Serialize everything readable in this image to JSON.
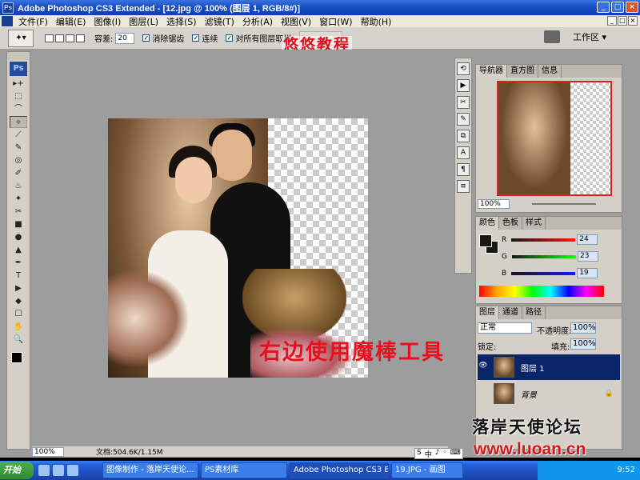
{
  "window": {
    "title": "Adobe Photoshop CS3 Extended - [12.jpg @ 100% (图层 1, RGB/8#)]",
    "minimize": "_",
    "maximize": "□",
    "close": "×"
  },
  "menu": [
    "文件(F)",
    "编辑(E)",
    "图像(I)",
    "图层(L)",
    "选择(S)",
    "滤镜(T)",
    "分析(A)",
    "视图(V)",
    "窗口(W)",
    "帮助(H)"
  ],
  "options": {
    "tolerance_label": "容差:",
    "tolerance_value": "20",
    "antialias_label": "消除锯齿",
    "contiguous_label": "连续",
    "sample_all_label": "对所有图层取样",
    "workspace_label": "工作区 ▾"
  },
  "overlay": {
    "brand": "悠悠教程",
    "caption": "右边使用魔棒工具"
  },
  "toolbox": {
    "ps_badge": "Ps",
    "tools": [
      "▸+",
      "⬚",
      "⌒",
      "✧",
      "⟋",
      "✎",
      "◎",
      "✐",
      "♨",
      "✦",
      "✂",
      "■",
      "●",
      "▲",
      "✒",
      "T",
      "▶",
      "◆",
      "☐",
      "✋",
      "🔍"
    ]
  },
  "navigator": {
    "tabs": [
      "导航器",
      "直方图",
      "信息"
    ],
    "zoom": "100%"
  },
  "color": {
    "tabs": [
      "颜色",
      "色板",
      "样式"
    ],
    "r": "24",
    "g": "23",
    "b": "19",
    "r_label": "R",
    "g_label": "G",
    "b_label": "B",
    "fg_color": "#181713"
  },
  "layers": {
    "tabs": [
      "图层",
      "通道",
      "路径"
    ],
    "blend_mode": "正常",
    "opacity_label": "不透明度:",
    "opacity_value": "100%",
    "lock_label": "锁定:",
    "fill_label": "填充:",
    "fill_value": "100%",
    "items": [
      {
        "name": "图层 1",
        "selected": true
      },
      {
        "name": "背景",
        "selected": false,
        "locked": true
      }
    ]
  },
  "status": {
    "zoom": "100%",
    "doc": "文档:504.6K/1.15M"
  },
  "watermark": {
    "forum": "落岸天使论坛",
    "url": "www.luoan.cn"
  },
  "taskbar": {
    "start": "开始",
    "tasks": [
      "图像制作 - 落岸天使论...",
      "PS素材库",
      "Adobe Photoshop CS3 E...",
      "19.JPG - 画图"
    ],
    "time": "9:52"
  },
  "ime": [
    "S",
    "中",
    "♪",
    "◦",
    "⌨"
  ]
}
